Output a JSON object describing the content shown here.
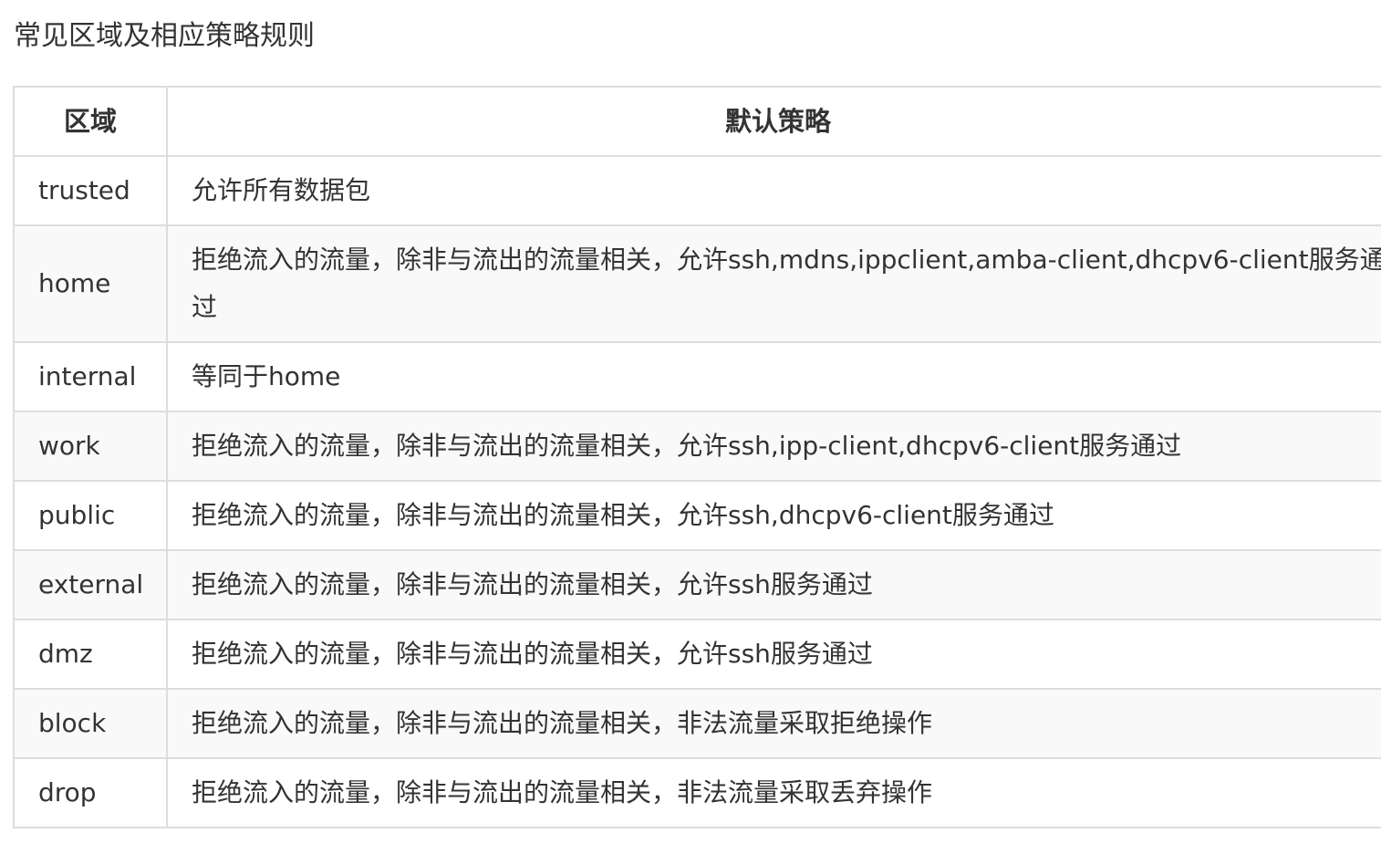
{
  "title": "常见区域及相应策略规则",
  "table": {
    "headers": {
      "zone": "区域",
      "policy": "默认策略"
    },
    "rows": [
      {
        "zone": "trusted",
        "policy": "允许所有数据包"
      },
      {
        "zone": "home",
        "policy": "拒绝流入的流量，除非与流出的流量相关，允许ssh,mdns,ippclient,amba-client,dhcpv6-client服务通过"
      },
      {
        "zone": "internal",
        "policy": "等同于home"
      },
      {
        "zone": "work",
        "policy": "拒绝流入的流量，除非与流出的流量相关，允许ssh,ipp-client,dhcpv6-client服务通过"
      },
      {
        "zone": "public",
        "policy": "拒绝流入的流量，除非与流出的流量相关，允许ssh,dhcpv6-client服务通过"
      },
      {
        "zone": "external",
        "policy": "拒绝流入的流量，除非与流出的流量相关，允许ssh服务通过"
      },
      {
        "zone": "dmz",
        "policy": "拒绝流入的流量，除非与流出的流量相关，允许ssh服务通过"
      },
      {
        "zone": "block",
        "policy": "拒绝流入的流量，除非与流出的流量相关，非法流量采取拒绝操作"
      },
      {
        "zone": "drop",
        "policy": "拒绝流入的流量，除非与流出的流量相关，非法流量采取丢弃操作"
      }
    ]
  },
  "colors": {
    "text": "#333333",
    "border": "#dddddd",
    "stripe": "#f9f9f9"
  }
}
